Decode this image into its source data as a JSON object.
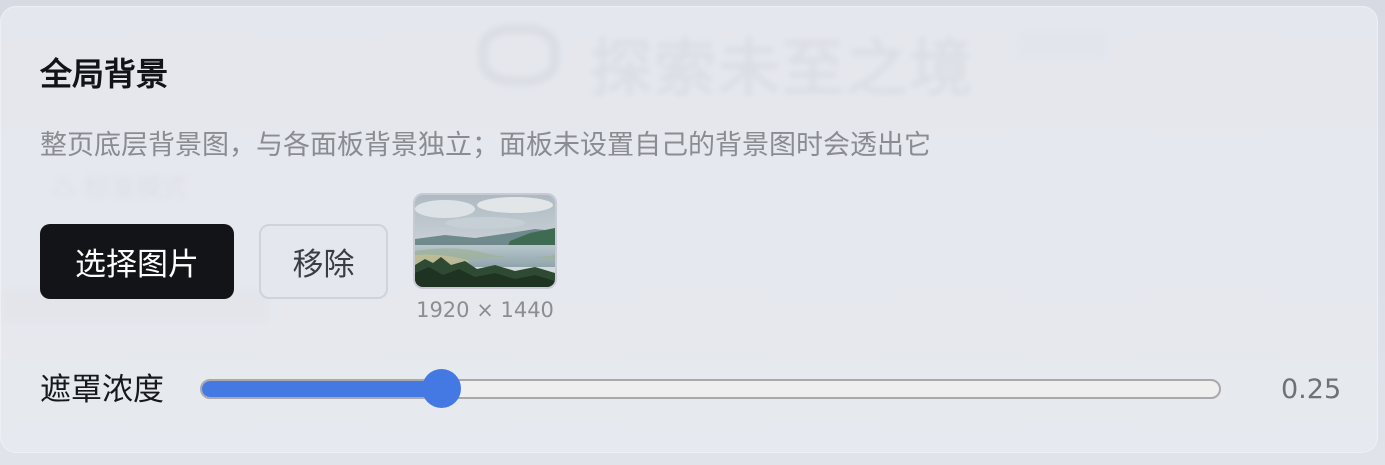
{
  "background_app": {
    "brand_name": "探索未至之境",
    "mode_label": "标准模式"
  },
  "panel": {
    "title": "全局背景",
    "description": "整页底层背景图，与各面板背景独立；面板未设置自己的背景图时会透出它",
    "buttons": {
      "choose_label": "选择图片",
      "remove_label": "移除"
    },
    "thumbnail": {
      "alt": "background image preview",
      "dimensions_text": "1920 × 1440"
    },
    "mask_slider": {
      "label": "遮罩浓度",
      "value": 0.25,
      "value_text": "0.25",
      "min": 0,
      "max": 1
    }
  },
  "colors": {
    "accent": "#4478e2",
    "primary_button": "#121418",
    "text_primary": "#111317",
    "text_secondary": "#8a8c92"
  }
}
